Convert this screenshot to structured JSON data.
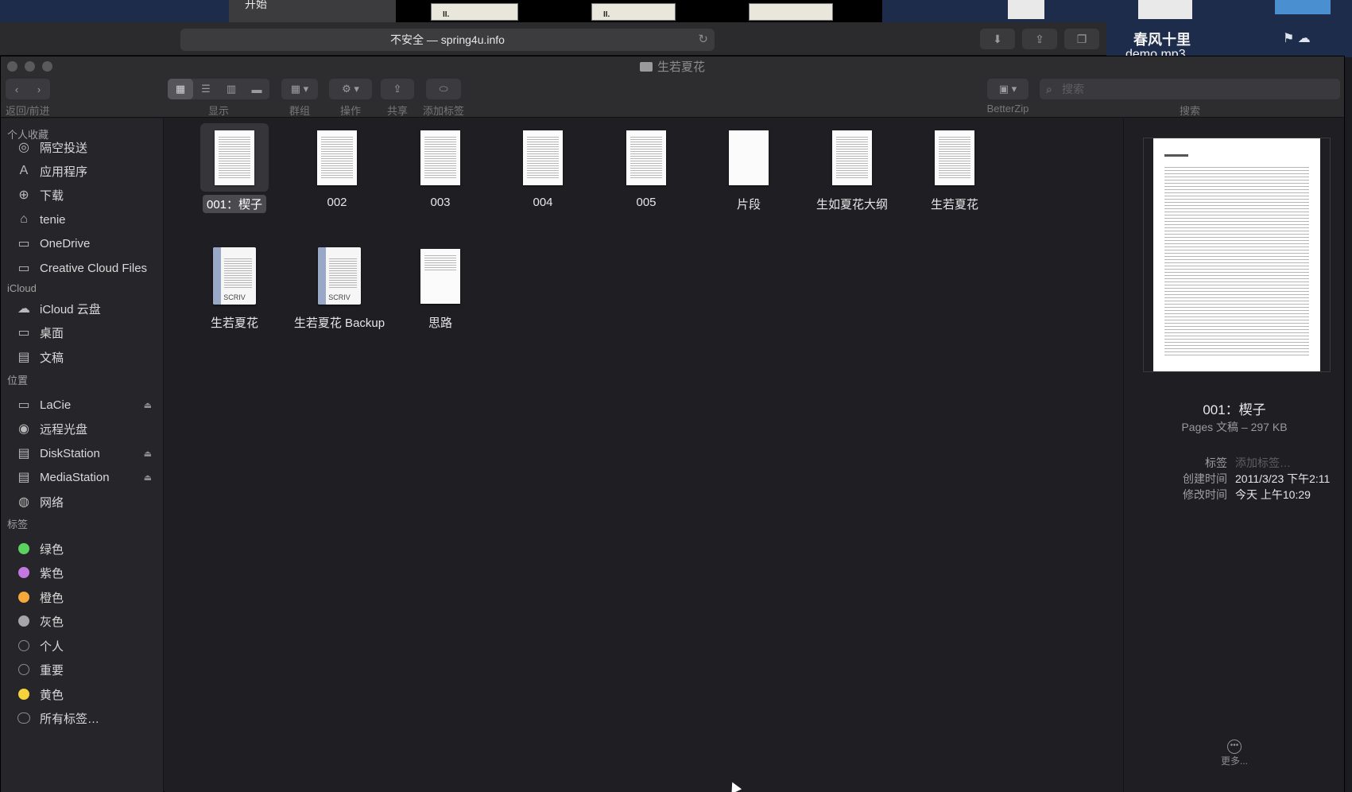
{
  "background": {
    "tab_label": "开始",
    "url_text": "不安全 — spring4u.info",
    "desktop_title": "春风十里",
    "desktop_subtitle": "demo.mp3"
  },
  "window": {
    "title": "生若夏花"
  },
  "toolbar": {
    "back_forward_label": "返回/前进",
    "view_label": "显示",
    "group_label": "群组",
    "action_label": "操作",
    "share_label": "共享",
    "tags_label": "添加标签",
    "betterzip_label": "BetterZip",
    "search_label": "搜索",
    "search_placeholder": "搜索"
  },
  "sidebar": {
    "favorites_header": "个人收藏",
    "favorites": [
      {
        "label": "隔空投送",
        "icon": "airdrop-icon"
      },
      {
        "label": "应用程序",
        "icon": "applications-icon"
      },
      {
        "label": "下载",
        "icon": "downloads-icon"
      },
      {
        "label": "tenie",
        "icon": "home-icon"
      },
      {
        "label": "OneDrive",
        "icon": "folder-icon"
      },
      {
        "label": "Creative Cloud Files",
        "icon": "folder-icon"
      }
    ],
    "icloud_header": "iCloud",
    "icloud": [
      {
        "label": "iCloud 云盘",
        "icon": "cloud-icon"
      },
      {
        "label": "桌面",
        "icon": "desktop-icon"
      },
      {
        "label": "文稿",
        "icon": "documents-icon"
      }
    ],
    "locations_header": "位置",
    "locations": [
      {
        "label": "LaCie",
        "icon": "drive-icon",
        "eject": true
      },
      {
        "label": "远程光盘",
        "icon": "disc-icon",
        "eject": false
      },
      {
        "label": "DiskStation",
        "icon": "server-icon",
        "eject": true
      },
      {
        "label": "MediaStation",
        "icon": "server-icon",
        "eject": true
      },
      {
        "label": "网络",
        "icon": "network-icon",
        "eject": false
      }
    ],
    "tags_header": "标签",
    "tags": [
      {
        "label": "绿色",
        "color": "#5bd15f"
      },
      {
        "label": "紫色",
        "color": "#c377e0"
      },
      {
        "label": "橙色",
        "color": "#f6a93b"
      },
      {
        "label": "灰色",
        "color": "#a6a6a8"
      },
      {
        "label": "个人",
        "color": ""
      },
      {
        "label": "重要",
        "color": ""
      },
      {
        "label": "黄色",
        "color": "#f6d33c"
      },
      {
        "label": "所有标签…",
        "color": "all"
      }
    ]
  },
  "files": [
    {
      "name": "001：楔子",
      "kind": "doc",
      "selected": true
    },
    {
      "name": "002",
      "kind": "doc"
    },
    {
      "name": "003",
      "kind": "doc"
    },
    {
      "name": "004",
      "kind": "doc"
    },
    {
      "name": "005",
      "kind": "doc"
    },
    {
      "name": "片段",
      "kind": "blank"
    },
    {
      "name": "生如夏花大纲",
      "kind": "doc"
    },
    {
      "name": "生若夏花",
      "kind": "doc"
    },
    {
      "name": "生若夏花",
      "kind": "scriv"
    },
    {
      "name": "生若夏花 Backup",
      "kind": "scriv"
    },
    {
      "name": "思路",
      "kind": "doc"
    }
  ],
  "preview": {
    "name": "001：楔子",
    "kind": "Pages 文稿 – 297 KB",
    "tags_key": "标签",
    "tags_value": "添加标签…",
    "created_key": "创建时间",
    "created_value": "2011/3/23 下午2:11",
    "modified_key": "修改时间",
    "modified_value": "今天 上午10:29",
    "more_label": "更多..."
  },
  "scriv_label": "SCRIV"
}
